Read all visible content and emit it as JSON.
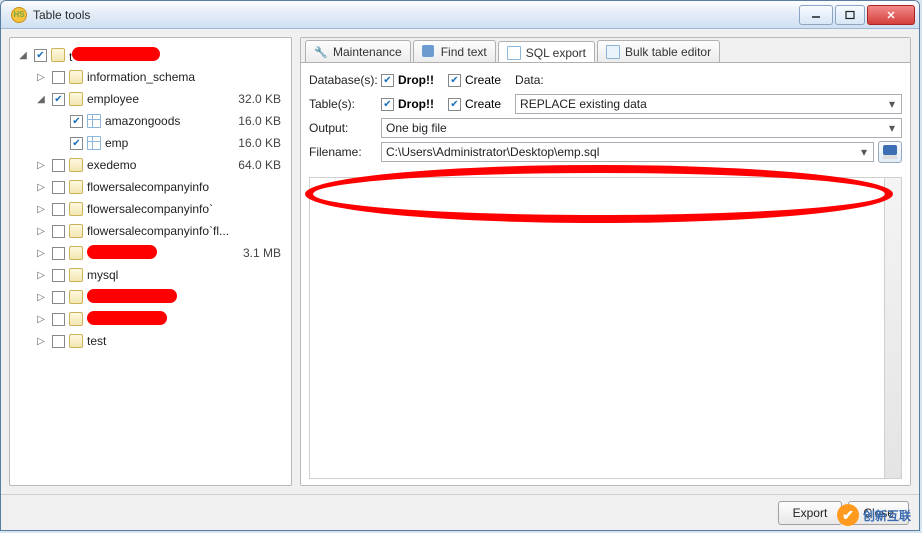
{
  "window": {
    "title": "Table tools",
    "app_icon_text": "HS"
  },
  "win_buttons": {
    "min": "_",
    "max": "▢",
    "close": "✕"
  },
  "tree": [
    {
      "indent": 0,
      "expander": "◢",
      "checked": true,
      "icon": "db",
      "label": "t",
      "redact_w": 88,
      "size": ""
    },
    {
      "indent": 1,
      "expander": "▷",
      "checked": false,
      "icon": "db",
      "label": "information_schema",
      "size": ""
    },
    {
      "indent": 1,
      "expander": "◢",
      "checked": true,
      "icon": "db",
      "label": "employee",
      "size": "32.0 KB"
    },
    {
      "indent": 2,
      "expander": "",
      "checked": true,
      "icon": "tbl",
      "label": "amazongoods",
      "size": "16.0 KB"
    },
    {
      "indent": 2,
      "expander": "",
      "checked": true,
      "icon": "tbl",
      "label": "emp",
      "size": "16.0 KB"
    },
    {
      "indent": 1,
      "expander": "▷",
      "checked": false,
      "icon": "db",
      "label": "exedemo",
      "size": "64.0 KB"
    },
    {
      "indent": 1,
      "expander": "▷",
      "checked": false,
      "icon": "db",
      "label": "flowersalecompanyinfo",
      "size": ""
    },
    {
      "indent": 1,
      "expander": "▷",
      "checked": false,
      "icon": "db",
      "label": "flowersalecompanyinfo`",
      "size": ""
    },
    {
      "indent": 1,
      "expander": "▷",
      "checked": false,
      "icon": "db",
      "label": "flowersalecompanyinfo`fl...",
      "size": ""
    },
    {
      "indent": 1,
      "expander": "▷",
      "checked": false,
      "icon": "db",
      "label": "",
      "redact_w": 70,
      "size": "3.1 MB"
    },
    {
      "indent": 1,
      "expander": "▷",
      "checked": false,
      "icon": "db",
      "label": "mysql",
      "size": ""
    },
    {
      "indent": 1,
      "expander": "▷",
      "checked": false,
      "icon": "db",
      "label": "",
      "redact_w": 90,
      "size": ""
    },
    {
      "indent": 1,
      "expander": "▷",
      "checked": false,
      "icon": "db",
      "label": "",
      "redact_w": 80,
      "size": ""
    },
    {
      "indent": 1,
      "expander": "▷",
      "checked": false,
      "icon": "db",
      "label": "test",
      "size": ""
    }
  ],
  "tabs": [
    {
      "label": "Maintenance",
      "icon": "wrench",
      "active": false
    },
    {
      "label": "Find text",
      "icon": "find",
      "active": false
    },
    {
      "label": "SQL export",
      "icon": "sql",
      "active": true
    },
    {
      "label": "Bulk table editor",
      "icon": "bulk",
      "active": false
    }
  ],
  "form": {
    "databases_label": "Database(s):",
    "tables_label": "Table(s):",
    "output_label": "Output:",
    "filename_label": "Filename:",
    "data_label": "Data:",
    "drop_label": "Drop!!",
    "create_label": "Create",
    "db_drop_checked": true,
    "db_create_checked": true,
    "tbl_drop_checked": true,
    "tbl_create_checked": true,
    "data_select": "REPLACE existing data",
    "output_select": "One big file",
    "filename_value": "C:\\Users\\Administrator\\Desktop\\emp.sql"
  },
  "footer": {
    "export": "Export",
    "close": "Close"
  },
  "watermark": {
    "text": "创新互联",
    "icon": "✔"
  }
}
